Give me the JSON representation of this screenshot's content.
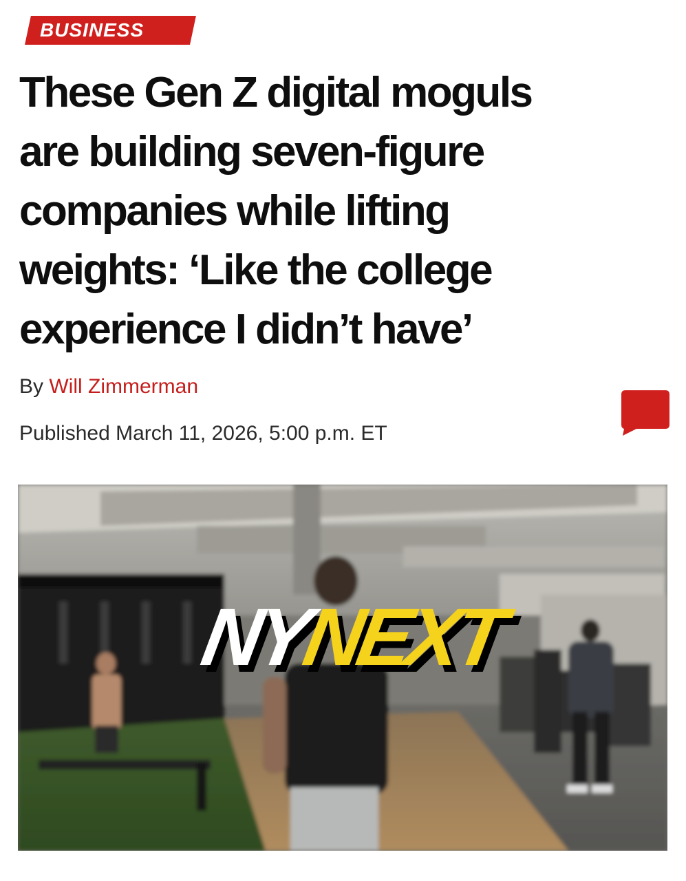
{
  "section": {
    "label": "BUSINESS",
    "color": "#d0201e"
  },
  "headline": {
    "lines": [
      "These Gen Z digital moguls",
      "are building seven-figure",
      "companies while lifting",
      "weights: ‘Like the college",
      "experience I didn’t have’"
    ]
  },
  "byline": {
    "prefix": "By",
    "author": "Will Zimmerman",
    "author_color": "#c41e1c"
  },
  "published": {
    "text": "Published March 11, 2026, 5:00 p.m. ET"
  },
  "comment_button": {
    "icon": "comment-bubble-icon",
    "color": "#d0201e"
  },
  "hero_image": {
    "logo": {
      "part1": "NY",
      "part2": "NEXT",
      "part1_color": "#ffffff",
      "part2_color": "#f5d21c"
    }
  }
}
